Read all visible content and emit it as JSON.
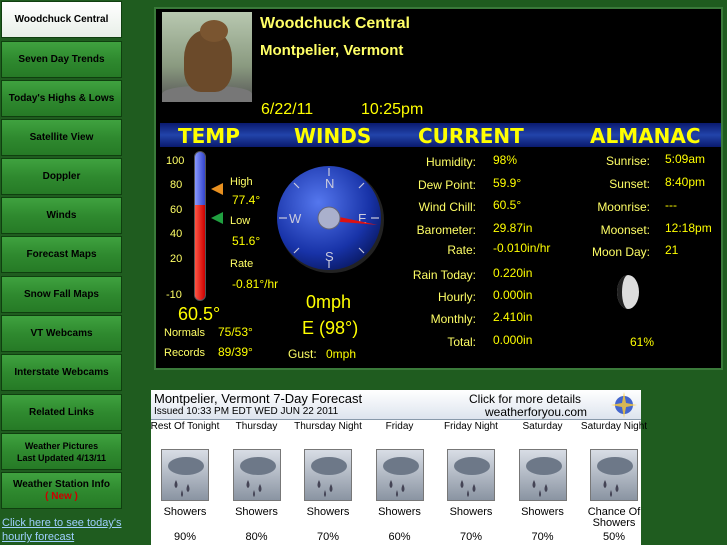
{
  "sidebar": {
    "items": [
      {
        "label": "Woodchuck Central",
        "active": true
      },
      {
        "label": "Seven Day Trends"
      },
      {
        "label": "Today's Highs & Lows"
      },
      {
        "label": "Satellite View"
      },
      {
        "label": "Doppler"
      },
      {
        "label": "Winds"
      },
      {
        "label": "Forecast Maps"
      },
      {
        "label": "Snow Fall Maps"
      },
      {
        "label": "VT Webcams"
      },
      {
        "label": "Interstate Webcams"
      },
      {
        "label": "Related Links"
      },
      {
        "label": "Weather Pictures",
        "sub": "Last Updated 4/13/11"
      },
      {
        "label": "Weather Station Info",
        "sub": "( New )"
      }
    ],
    "hourly_link": "Click here to see today's hourly forecast"
  },
  "header": {
    "title": "Woodchuck Central",
    "location": "Montpelier, Vermont",
    "date": "6/22/11",
    "time": "10:25pm"
  },
  "sections": [
    "TEMP",
    "WINDS",
    "CURRENT",
    "ALMANAC"
  ],
  "temp": {
    "scale_ticks": [
      "100",
      "80",
      "60",
      "40",
      "20",
      "-10"
    ],
    "high_label": "High",
    "high": "77.4°",
    "low_label": "Low",
    "low": "51.6°",
    "rate_label": "Rate",
    "rate": "-0.81°/hr",
    "current": "60.5°",
    "normals_label": "Normals",
    "normals": "75/53°",
    "records_label": "Records",
    "records": "89/39°",
    "fill_fraction": 0.64
  },
  "winds": {
    "compass": {
      "n": "N",
      "e": "E",
      "s": "S",
      "w": "W"
    },
    "speed": "0mph",
    "direction": "E (98°)",
    "gust_label": "Gust:",
    "gust": "0mph",
    "direction_degrees": 98
  },
  "current": [
    {
      "label": "Humidity:",
      "value": "98%"
    },
    {
      "label": "Dew Point:",
      "value": "59.9°"
    },
    {
      "label": "Wind Chill:",
      "value": "60.5°"
    },
    {
      "label": "Barometer:",
      "value": "29.87in"
    },
    {
      "label": "Rate:",
      "value": "-0.010in/hr"
    },
    {
      "label": "Rain Today:",
      "value": "0.220in"
    },
    {
      "label": "Hourly:",
      "value": "0.000in"
    },
    {
      "label": "Monthly:",
      "value": "2.410in"
    },
    {
      "label": "Total:",
      "value": "0.000in"
    }
  ],
  "almanac": [
    {
      "label": "Sunrise:",
      "value": "5:09am"
    },
    {
      "label": "Sunset:",
      "value": "8:40pm"
    },
    {
      "label": "Moonrise:",
      "value": "---"
    },
    {
      "label": "Moonset:",
      "value": "12:18pm"
    },
    {
      "label": "Moon Day:",
      "value": "21"
    }
  ],
  "moon_illumination": "61%",
  "forecast": {
    "title": "Montpelier, Vermont 7-Day Forecast",
    "issued": "Issued 10:33 PM EDT WED JUN 22 2011",
    "click_text": "Click for more details",
    "site": "weatherforyou.com",
    "days": [
      {
        "day": "Rest Of Tonight",
        "cond": "Showers",
        "pct": "90%"
      },
      {
        "day": "Thursday",
        "cond": "Showers",
        "pct": "80%"
      },
      {
        "day": "Thursday Night",
        "cond": "Showers",
        "pct": "70%"
      },
      {
        "day": "Friday",
        "cond": "Showers",
        "pct": "60%"
      },
      {
        "day": "Friday Night",
        "cond": "Showers",
        "pct": "70%"
      },
      {
        "day": "Saturday",
        "cond": "Showers",
        "pct": "70%"
      },
      {
        "day": "Saturday Night",
        "cond": "Chance Of Showers",
        "pct": "50%"
      }
    ]
  }
}
